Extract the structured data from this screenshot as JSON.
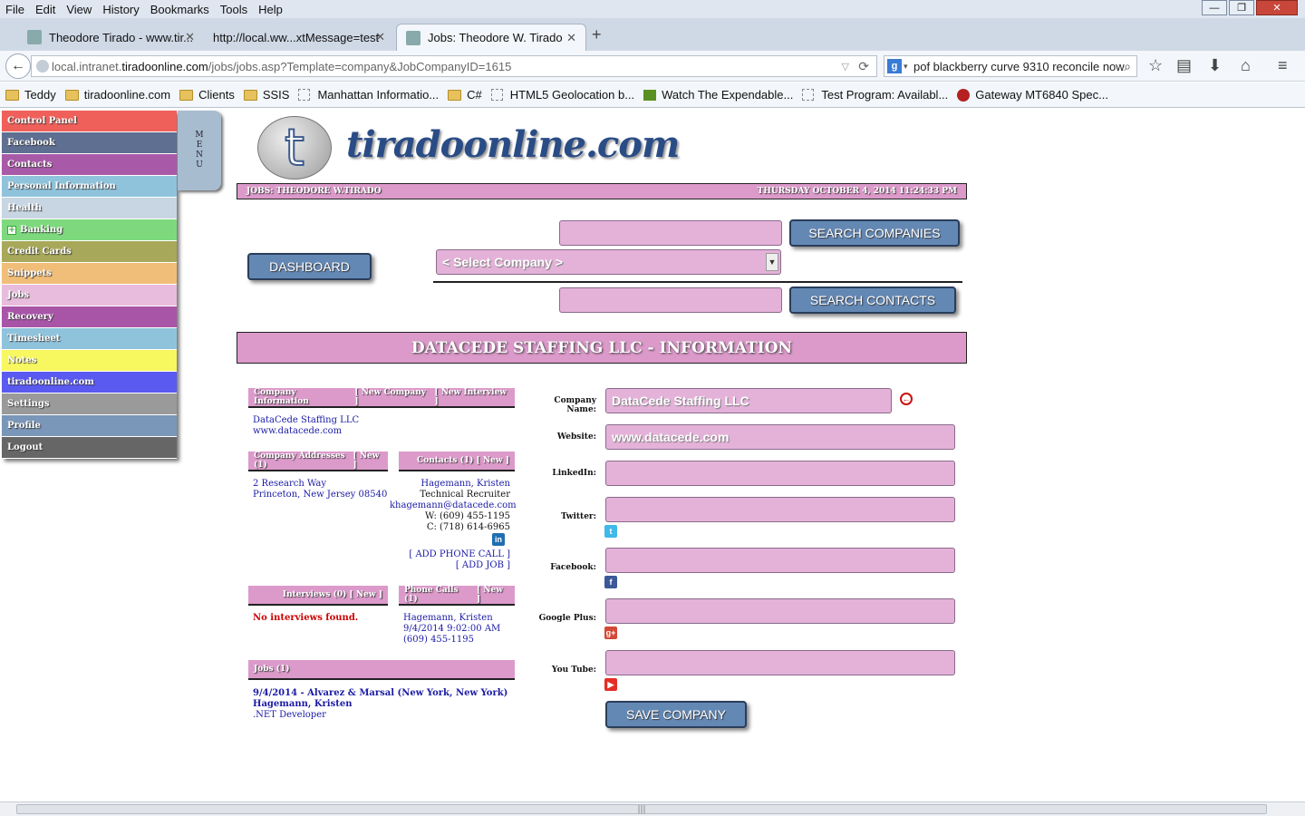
{
  "browser": {
    "menu": [
      "File",
      "Edit",
      "View",
      "History",
      "Bookmarks",
      "Tools",
      "Help"
    ],
    "window_controls": [
      "—",
      "❐",
      "✕"
    ],
    "tabs": [
      {
        "label": "Theodore Tirado - www.tir..."
      },
      {
        "label": "http://local.ww...xtMessage=test"
      },
      {
        "label": "Jobs: Theodore W. Tirado"
      }
    ],
    "url_prefix": "local.intranet.",
    "url_host": "tiradoonline.com",
    "url_path": "/jobs/jobs.asp?Template=company&JobCompanyID=1615",
    "search_value": "pof blackberry curve 9310 reconcile now",
    "bookmarks": [
      {
        "label": "Teddy",
        "icon": "folder-icon"
      },
      {
        "label": "tiradoonline.com",
        "icon": "folder-icon"
      },
      {
        "label": "Clients",
        "icon": "folder-icon"
      },
      {
        "label": "SSIS",
        "icon": "folder-icon"
      },
      {
        "label": "Manhattan Informatio...",
        "icon": "page-icon"
      },
      {
        "label": "C#",
        "icon": "folder-icon"
      },
      {
        "label": "HTML5 Geolocation b...",
        "icon": "page-icon"
      },
      {
        "label": "Watch The Expendable...",
        "icon": "video-icon"
      },
      {
        "label": "Test Program: Availabl...",
        "icon": "page-icon"
      },
      {
        "label": "Gateway MT6840 Spec...",
        "icon": "gateway-icon"
      }
    ]
  },
  "sidemenu": {
    "items": [
      {
        "label": "Control Panel",
        "color": "#f0605a"
      },
      {
        "label": "Facebook",
        "color": "#5e6f92"
      },
      {
        "label": "Contacts",
        "color": "#a85aa8"
      },
      {
        "label": "Personal Information",
        "color": "#8fc3dc"
      },
      {
        "label": "Health",
        "color": "#c8d6e3"
      },
      {
        "label": "Banking",
        "color": "#7ed97e"
      },
      {
        "label": "Credit Cards",
        "color": "#a8a85a"
      },
      {
        "label": "Snippets",
        "color": "#f0be78"
      },
      {
        "label": "Jobs",
        "color": "#e8bcdc"
      },
      {
        "label": "Recovery",
        "color": "#a855a8"
      },
      {
        "label": "Timesheet",
        "color": "#8fc3dc"
      },
      {
        "label": "Notes",
        "color": "#f7f760"
      },
      {
        "label": "tiradoonline.com",
        "color": "#5a5af0"
      },
      {
        "label": "Settings",
        "color": "#9a9a9a"
      },
      {
        "label": "Profile",
        "color": "#7a96b8"
      },
      {
        "label": "Logout",
        "color": "#666666"
      }
    ],
    "tab_letters": [
      "M",
      "E",
      "N",
      "U"
    ]
  },
  "logo": {
    "letter": "t",
    "text": "tiradoonline.com"
  },
  "header": {
    "left": "JOBS: THEODORE W.TIRADO",
    "right": "THURSDAY OCTOBER 4, 2014 11:24:33 PM"
  },
  "search": {
    "companies_button": "SEARCH COMPANIES",
    "contacts_button": "SEARCH CONTACTS",
    "dashboard_button": "DASHBOARD",
    "select_company": "< Select Company >"
  },
  "banner": "DATACEDE STAFFING LLC - INFORMATION",
  "sections": {
    "company_info": {
      "title": "Company Information",
      "new_company": "[ New Company ]",
      "new_interview": "[ New Interview ]",
      "name": "DataCede Staffing LLC",
      "website": "www.datacede.com"
    },
    "addresses": {
      "title": "Company Addresses (1)",
      "new": "[ New ]",
      "line1": "2 Research Way",
      "line2": "Princeton,  New Jersey  08540"
    },
    "contacts": {
      "title": "Contacts (1)",
      "new": "[ New ]",
      "name": "Hagemann, Kristen",
      "role": "Technical Recruiter",
      "email": "khagemann@datacede.com",
      "work": "W: (609) 455-1195",
      "cell": "C: (718) 614-6965",
      "add_phone_call": "[ ADD PHONE CALL ]",
      "add_job": "[ ADD JOB ]"
    },
    "interviews": {
      "title": "Interviews (0)",
      "new": "[ New ]",
      "empty": "No interviews found."
    },
    "phone_calls": {
      "title": "Phone Calls (1)",
      "new": "[ New ]",
      "name": "Hagemann, Kristen",
      "datetime": "9/4/2014 9:02:00 AM",
      "phone": "(609) 455-1195"
    },
    "jobs": {
      "title": "Jobs (1)",
      "line1": "9/4/2014 -  Alvarez & Marsal  (New York, New York)",
      "line2": "Hagemann, Kristen",
      "line3": ".NET Developer"
    }
  },
  "form": {
    "company_name_label": "Company Name:",
    "company_name_value": "DataCede Staffing LLC",
    "website_label": "Website:",
    "website_value": "www.datacede.com",
    "linkedin_label": "LinkedIn:",
    "twitter_label": "Twitter:",
    "facebook_label": "Facebook:",
    "googleplus_label": "Google Plus:",
    "youtube_label": "You Tube:",
    "save_button": "SAVE COMPANY"
  }
}
